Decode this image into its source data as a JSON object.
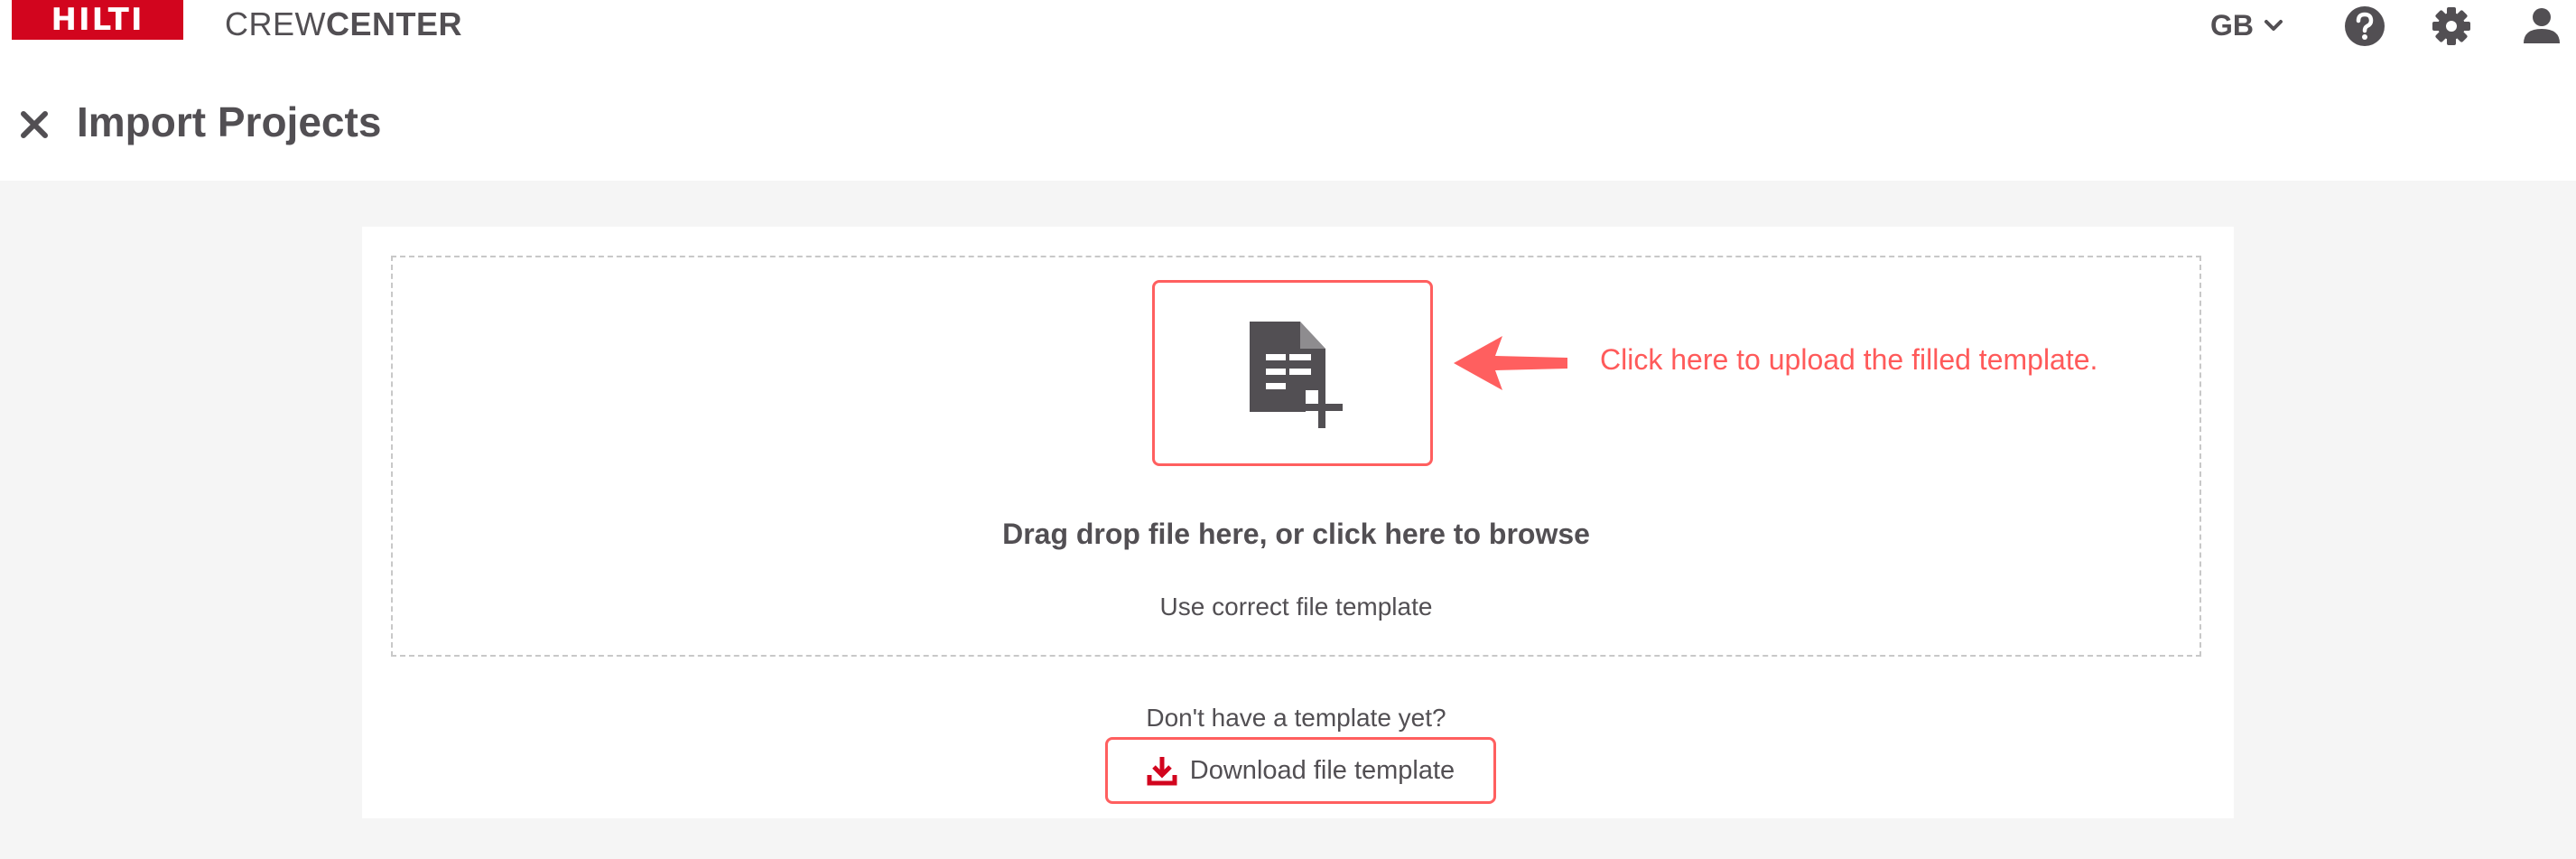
{
  "header": {
    "logo_text": "HILTI",
    "app_name_light": "CREW",
    "app_name_bold": "CENTER",
    "region": "GB"
  },
  "page": {
    "title": "Import Projects"
  },
  "upload": {
    "annotation": "Click here to upload the filled template.",
    "drop_title": "Drag drop file here, or click here to browse",
    "drop_subtitle": "Use correct file template"
  },
  "template": {
    "prompt": "Don't have a template yet?",
    "download_label": "Download file template"
  },
  "colors": {
    "brand": "#d2051e",
    "highlight": "#ff5f5f",
    "text": "#524f53",
    "background": "#f5f5f5"
  },
  "icons": [
    "hilti-logo",
    "chevron-down-icon",
    "help-icon",
    "gear-icon",
    "user-icon",
    "close-icon",
    "add-file-icon",
    "arrow-left-icon",
    "download-icon"
  ]
}
